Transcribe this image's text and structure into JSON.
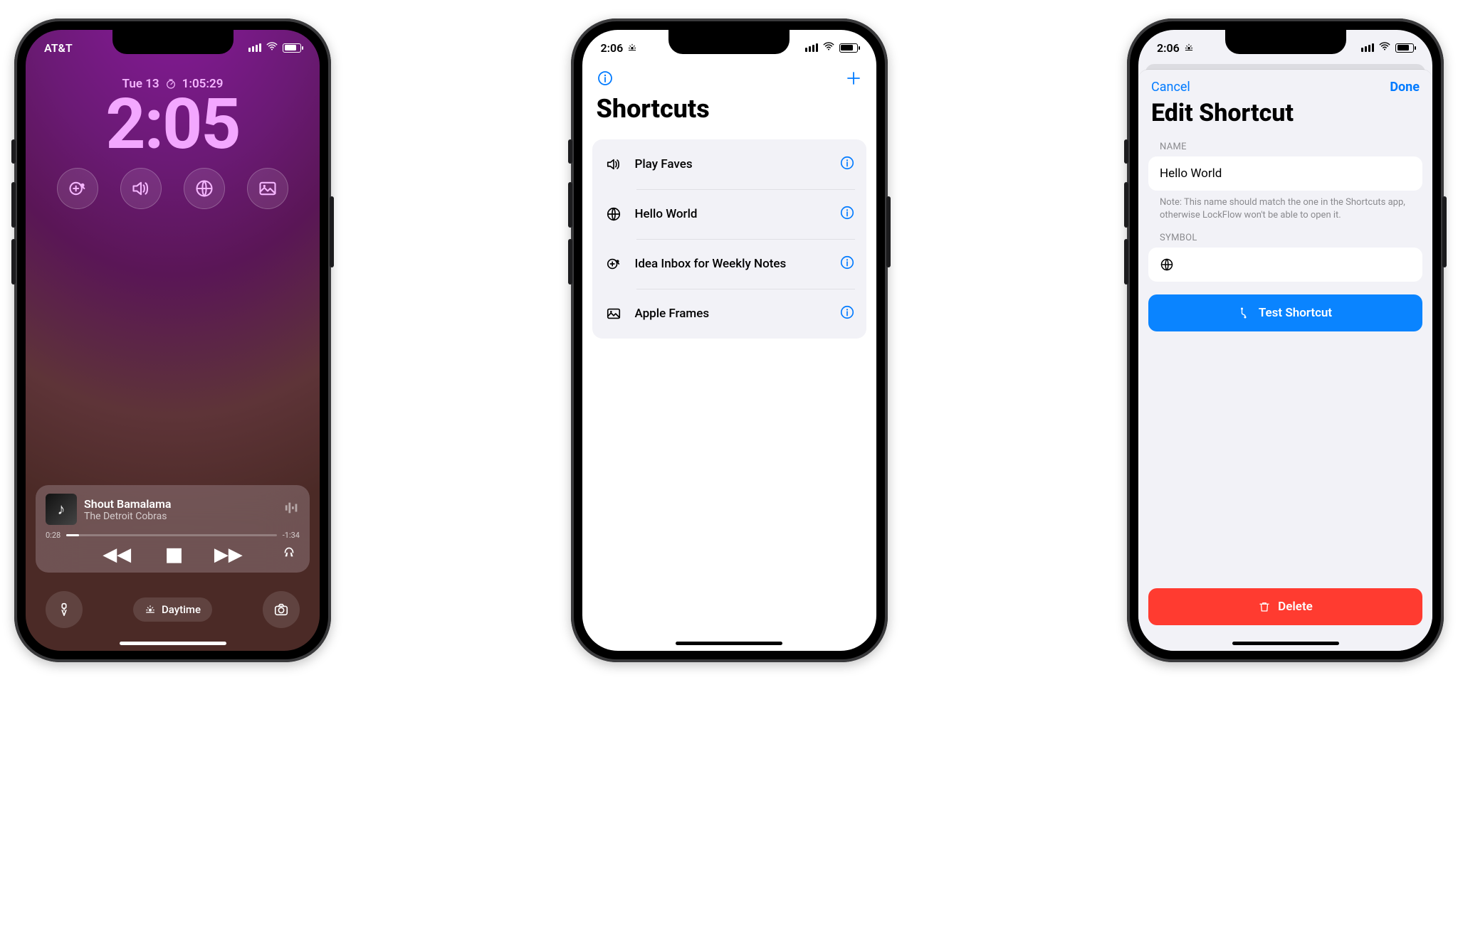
{
  "screen1": {
    "status": {
      "carrier": "AT&T"
    },
    "date_line": "Tue 13",
    "timer": "1:05:29",
    "clock": "2:05",
    "widgets": [
      "add-note-icon",
      "speaker-icon",
      "globe-icon",
      "photo-icon"
    ],
    "music": {
      "title": "Shout Bamalama",
      "artist": "The Detroit Cobras",
      "elapsed": "0:28",
      "remaining": "-1:34"
    },
    "focus": "Daytime"
  },
  "screen2": {
    "status_time": "2:06",
    "title": "Shortcuts",
    "rows": [
      {
        "icon": "speaker-icon",
        "label": "Play Faves"
      },
      {
        "icon": "globe-icon",
        "label": "Hello World"
      },
      {
        "icon": "add-note-icon",
        "label": "Idea Inbox for Weekly Notes"
      },
      {
        "icon": "photo-icon",
        "label": "Apple Frames"
      }
    ]
  },
  "screen3": {
    "status_time": "2:06",
    "cancel": "Cancel",
    "done": "Done",
    "title": "Edit Shortcut",
    "name_label": "NAME",
    "name_value": "Hello World",
    "name_note": "Note: This name should match the one in the Shortcuts app, otherwise LockFlow won't be able to open it.",
    "symbol_label": "SYMBOL",
    "test_label": "Test Shortcut",
    "delete_label": "Delete"
  }
}
